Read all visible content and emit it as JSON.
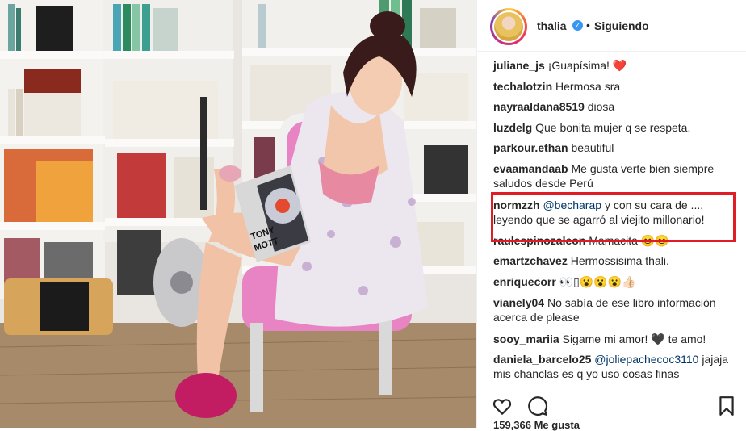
{
  "post": {
    "username": "thalia",
    "follow_status": "Siguiendo",
    "separator": "•",
    "verified_glyph": "✓",
    "likes_text": "159,366 Me gusta"
  },
  "comments": [
    {
      "user": "juliane_js",
      "text": "¡Guapísima! ❤️"
    },
    {
      "user": "techalotzin",
      "text": "Hermosa sra"
    },
    {
      "user": "nayraaldana8519",
      "text": "diosa"
    },
    {
      "user": "luzdelg",
      "text": "Que bonita mujer q se respeta."
    },
    {
      "user": "parkour.ethan",
      "text": "beautiful"
    },
    {
      "user": "evaamandaab",
      "text": "Me gusta verte bien siempre saludos desde Perú"
    },
    {
      "user": "normzzh",
      "mention": "@becharap",
      "text": "y con su cara de .... leyendo que se agarró al viejito millonario!"
    },
    {
      "user": "raulespinozaleon",
      "text": "Mamacita 😊😊"
    },
    {
      "user": "emartzchavez",
      "text": "Hermossisima thali."
    },
    {
      "user": "enriquecorr",
      "text": "👀▯😮😮😮👍🏻"
    },
    {
      "user": "vianely04",
      "text": "No sabía de ese libro información acerca de please"
    },
    {
      "user": "sooy_mariia",
      "text": "Sigame mi amor! 🖤 te amo!"
    },
    {
      "user": "daniela_barcelo25",
      "mention": "@joliepachecoc3110",
      "text": "jajaja mis chanclas es q yo uso cosas finas"
    }
  ],
  "photo": {
    "book_title_line1": "TONY",
    "book_title_line2": "MOTT"
  },
  "colors": {
    "highlight": "#e01c25",
    "mention": "#003569",
    "verified": "#3897f0"
  },
  "icons": [
    "heart-icon",
    "comment-icon",
    "bookmark-icon",
    "verified-icon"
  ]
}
